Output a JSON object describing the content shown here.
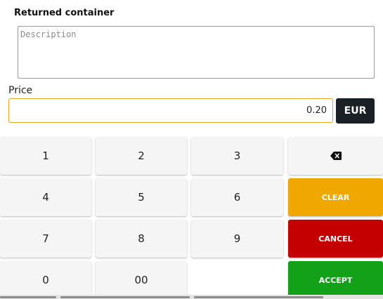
{
  "form": {
    "title": "Returned container",
    "description_placeholder": "Description",
    "description_value": "",
    "price_label": "Price",
    "price_value": "0.20",
    "currency": "EUR"
  },
  "keypad": {
    "digits": [
      "1",
      "2",
      "3",
      "4",
      "5",
      "6",
      "7",
      "8",
      "9",
      "0",
      "00"
    ],
    "backspace_icon": "backspace-icon",
    "clear_label": "CLEAR",
    "cancel_label": "CANCEL",
    "accept_label": "ACCEPT"
  },
  "colors": {
    "accent_border": "#e3a524",
    "currency_bg": "#1b2026",
    "clear": "#f0a800",
    "cancel": "#c40000",
    "accept": "#13a11a",
    "key_bg": "#f5f5f5"
  }
}
